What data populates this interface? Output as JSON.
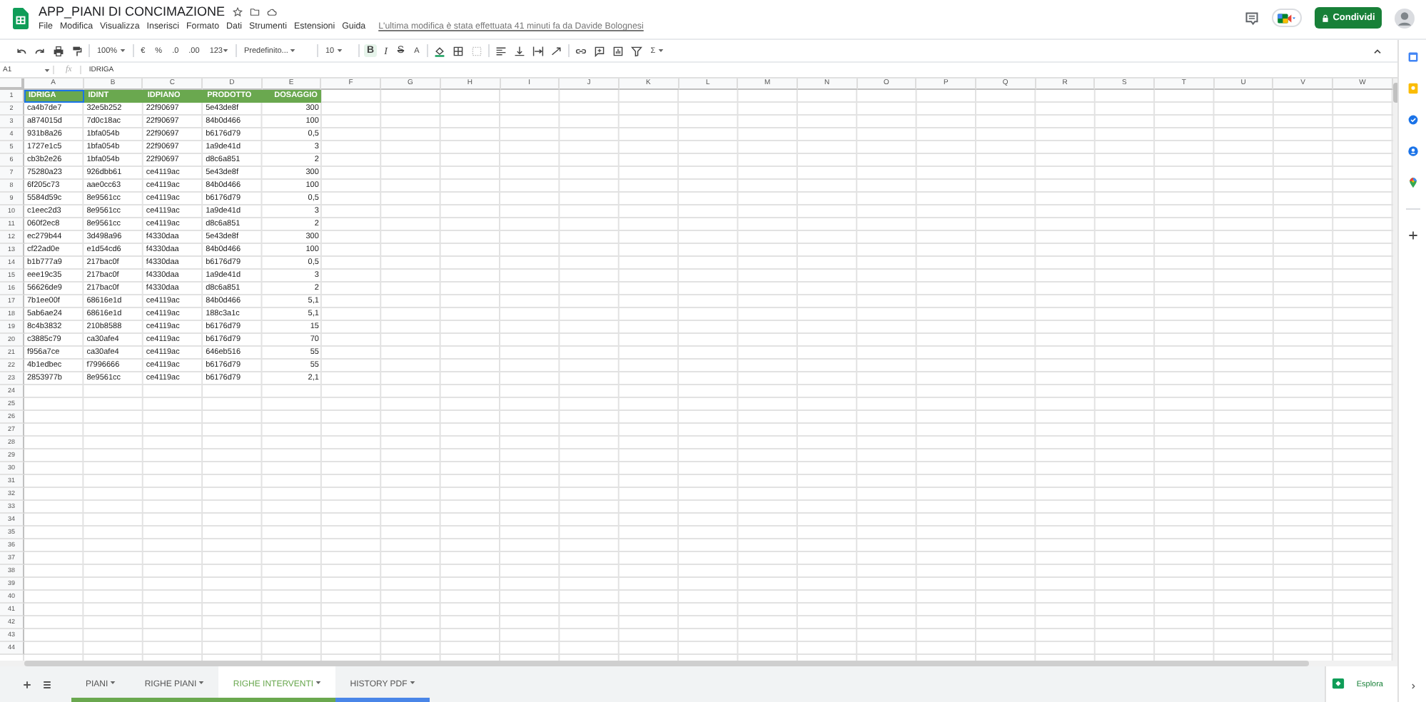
{
  "document": {
    "title": "APP_PIANI DI CONCIMAZIONE",
    "last_edit": "L'ultima modifica è stata effettuata 41 minuti fa da Davide Bolognesi"
  },
  "menu": [
    "File",
    "Modifica",
    "Visualizza",
    "Inserisci",
    "Formato",
    "Dati",
    "Strumenti",
    "Estensioni",
    "Guida"
  ],
  "share_button": "Condividi",
  "toolbar": {
    "zoom": "100%",
    "currency": "€",
    "percent": "%",
    "decrease_decimals": ".0",
    "increase_decimals": ".00",
    "number_format": "123",
    "font": "Predefinito...",
    "font_size": "10",
    "bold": "B",
    "bold_on": true,
    "italic": "I",
    "strikethrough": "S",
    "text_color": "A",
    "functions": "Σ"
  },
  "formula_bar": {
    "name_box": "A1",
    "fx": "fx",
    "formula": "IDRIGA"
  },
  "column_headers": [
    "A",
    "B",
    "C",
    "D",
    "E",
    "F",
    "G",
    "H",
    "I",
    "J",
    "K",
    "L",
    "M",
    "N",
    "O",
    "P",
    "Q",
    "R",
    "S",
    "T",
    "U",
    "V",
    "W"
  ],
  "row_numbers": [
    "1",
    "2",
    "3",
    "4",
    "5",
    "6",
    "7",
    "8",
    "9",
    "10",
    "11",
    "12",
    "13",
    "14",
    "15",
    "16",
    "17",
    "18",
    "19",
    "20",
    "21",
    "22",
    "23",
    "24",
    "25",
    "26",
    "27",
    "28",
    "29",
    "30",
    "31",
    "32",
    "33",
    "34",
    "35",
    "36",
    "37",
    "38",
    "39",
    "40",
    "41",
    "42",
    "43",
    "44"
  ],
  "table": {
    "header": [
      {
        "text": "IDRIGA",
        "selected": true
      },
      {
        "text": "IDINT",
        "selected": false
      },
      {
        "text": "IDPIANO",
        "selected": false
      },
      {
        "text": "PRODOTTO",
        "selected": false
      },
      {
        "text": "DOSAGGIO",
        "selected": false
      }
    ],
    "rows": [
      [
        "ca4b7de7",
        "32e5b252",
        "22f90697",
        "5e43de8f",
        "300"
      ],
      [
        "a874015d",
        "7d0c18ac",
        "22f90697",
        "84b0d466",
        "100"
      ],
      [
        "931b8a26",
        "1bfa054b",
        "22f90697",
        "b6176d79",
        "0,5"
      ],
      [
        "1727e1c5",
        "1bfa054b",
        "22f90697",
        "1a9de41d",
        "3"
      ],
      [
        "cb3b2e26",
        "1bfa054b",
        "22f90697",
        "d8c6a851",
        "2"
      ],
      [
        "75280a23",
        "926dbb61",
        "ce4119ac",
        "5e43de8f",
        "300"
      ],
      [
        "6f205c73",
        "aae0cc63",
        "ce4119ac",
        "84b0d466",
        "100"
      ],
      [
        "5584d59c",
        "8e9561cc",
        "ce4119ac",
        "b6176d79",
        "0,5"
      ],
      [
        "c1eec2d3",
        "8e9561cc",
        "ce4119ac",
        "1a9de41d",
        "3"
      ],
      [
        "060f2ec8",
        "8e9561cc",
        "ce4119ac",
        "d8c6a851",
        "2"
      ],
      [
        "ec279b44",
        "3d498a96",
        "f4330daa",
        "5e43de8f",
        "300"
      ],
      [
        "cf22ad0e",
        "e1d54cd6",
        "f4330daa",
        "84b0d466",
        "100"
      ],
      [
        "b1b777a9",
        "217bac0f",
        "f4330daa",
        "b6176d79",
        "0,5"
      ],
      [
        "eee19c35",
        "217bac0f",
        "f4330daa",
        "1a9de41d",
        "3"
      ],
      [
        "56626de9",
        "217bac0f",
        "f4330daa",
        "d8c6a851",
        "2"
      ],
      [
        "7b1ee00f",
        "68616e1d",
        "ce4119ac",
        "84b0d466",
        "5,1"
      ],
      [
        "5ab6ae24",
        "68616e1d",
        "ce4119ac",
        "188c3a1c",
        "5,1"
      ],
      [
        "8c4b3832",
        "210b8588",
        "ce4119ac",
        "b6176d79",
        "15"
      ],
      [
        "c3885c79",
        "ca30afe4",
        "ce4119ac",
        "b6176d79",
        "70"
      ],
      [
        "f956a7ce",
        "ca30afe4",
        "ce4119ac",
        "646eb516",
        "55"
      ],
      [
        "4b1edbec",
        "f7996666",
        "ce4119ac",
        "b6176d79",
        "55"
      ],
      [
        "2853977b",
        "8e9561cc",
        "ce4119ac",
        "b6176d79",
        "2,1"
      ]
    ]
  },
  "sheet_tabs": [
    {
      "label": "PIANI",
      "selected": false,
      "color": "#6aa84f"
    },
    {
      "label": "RIGHE PIANI",
      "selected": false,
      "color": "#6aa84f"
    },
    {
      "label": "RIGHE INTERVENTI",
      "selected": true,
      "color": "#6aa84f"
    },
    {
      "label": "HISTORY PDF",
      "selected": false,
      "color": "#4a86e8"
    }
  ],
  "explore_button": "Esplora"
}
